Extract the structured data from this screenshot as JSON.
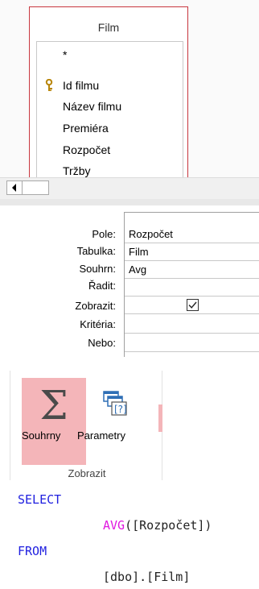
{
  "designer": {
    "table": {
      "title": "Film",
      "fields": [
        {
          "label": "*",
          "is_key": false
        },
        {
          "label": "Id filmu",
          "is_key": true
        },
        {
          "label": "Název filmu",
          "is_key": false
        },
        {
          "label": "Premiéra",
          "is_key": false
        },
        {
          "label": "Rozpočet",
          "is_key": false
        },
        {
          "label": "Tržby",
          "is_key": false
        }
      ]
    },
    "colors": {
      "table_border": "#c8363e"
    }
  },
  "query_grid": {
    "rows": [
      {
        "label": "Pole:",
        "value": "Rozpočet"
      },
      {
        "label": "Tabulka:",
        "value": "Film"
      },
      {
        "label": "Souhrn:",
        "value": "Avg"
      },
      {
        "label": "Řadit:",
        "value": ""
      },
      {
        "label": "Zobrazit:",
        "value": "",
        "checked": true
      },
      {
        "label": "Kritéria:",
        "value": ""
      },
      {
        "label": "Nebo:",
        "value": ""
      }
    ]
  },
  "ribbon": {
    "buttons": [
      {
        "label": "Souhrny",
        "icon": "sigma-icon",
        "highlighted": true
      },
      {
        "label": "Parametry",
        "icon": "parameters-icon",
        "highlighted": false
      }
    ],
    "group_label": "Zobrazit",
    "colors": {
      "highlight": "#f4b5b9"
    }
  },
  "sql": {
    "select_kw": "SELECT",
    "fn_name": "AVG",
    "fn_args": "([Rozpočet])",
    "from_kw": "FROM",
    "table_ref": "[dbo].[Film]",
    "colors": {
      "keyword": "#1f1fdf",
      "function": "#e018e0"
    }
  }
}
